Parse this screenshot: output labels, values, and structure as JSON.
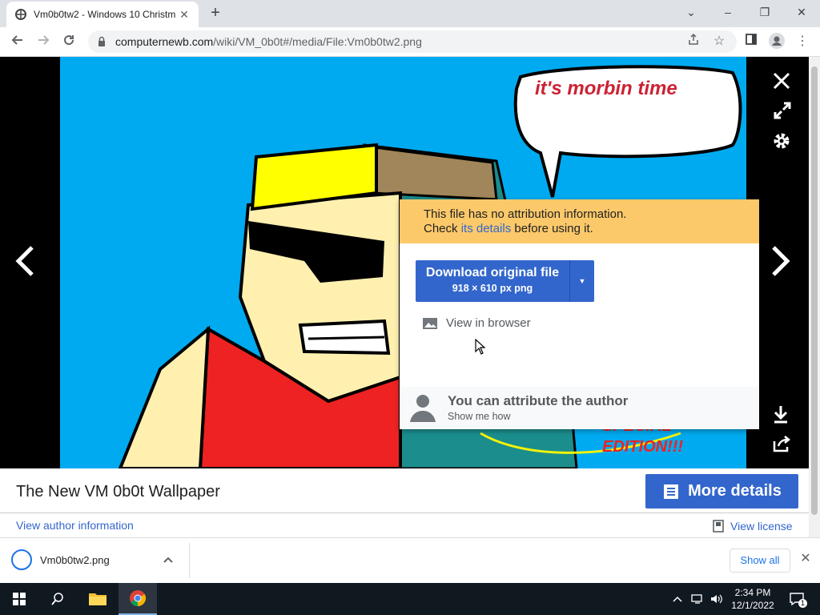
{
  "tab": {
    "title": "Vm0b0tw2 - Windows 10 Christm",
    "close": "✕"
  },
  "new_tab": "+",
  "window_controls": {
    "minimize": "–",
    "restore": "❐",
    "close": "✕",
    "tabsearch": "⌄"
  },
  "address": {
    "host": "computernewb.com",
    "path": "/wiki/VM_0b0t#/media/File:Vm0b0tw2.png"
  },
  "image": {
    "speech_text": "it's morbin time",
    "caption_line1": "SPECIAL",
    "caption_line2": "EDITION!!!"
  },
  "popup": {
    "warn_line1": "This file has no attribution information.",
    "warn_check": "Check ",
    "warn_link": "its details",
    "warn_after": " before using it.",
    "download_label": "Download original file",
    "download_sub": "918 × 610 px png",
    "view_in_browser": "View in browser",
    "attrib_title": "You can attribute the author",
    "attrib_sub": "Show me how"
  },
  "meta": {
    "file_title": "The New VM 0b0t Wallpaper",
    "more_details": "More details",
    "author_link": "View author information",
    "license_link": "View license"
  },
  "downloads": {
    "filename": "Vm0b0tw2.png",
    "show_all": "Show all"
  },
  "clock": {
    "time": "2:34 PM",
    "date": "12/1/2022"
  },
  "notification_count": "1",
  "colors": {
    "accent": "#3366cc",
    "warn": "#fcc96a",
    "sky": "#00aaf0"
  }
}
